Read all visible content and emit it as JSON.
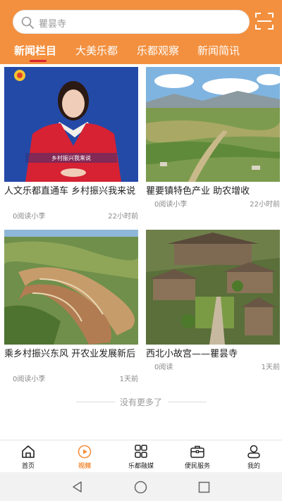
{
  "search": {
    "placeholder": "瞿昙寺"
  },
  "tabs": [
    {
      "label": "新闻栏目",
      "active": true
    },
    {
      "label": "大美乐都",
      "active": false
    },
    {
      "label": "乐都观察",
      "active": false
    },
    {
      "label": "新闻简讯",
      "active": false
    }
  ],
  "cards": [
    {
      "title": "人文乐都直通车 乡村振兴我来说",
      "reads": "0阅读小李",
      "time": "22小时前",
      "overlay_text": "乡村振兴我来说"
    },
    {
      "title": "瞿要镇特色产业 助农增收",
      "reads": "0阅读小李",
      "time": "22小时前"
    },
    {
      "title": "乘乡村振兴东风 开农业发展新后",
      "reads": "0阅读小李",
      "time": "1天前"
    },
    {
      "title": "西北小故宫——瞿昙寺",
      "reads": "0阅读",
      "time": "1天前"
    }
  ],
  "footer": {
    "no_more": "没有更多了"
  },
  "nav": [
    {
      "label": "首页",
      "icon": "home-icon",
      "active": false
    },
    {
      "label": "视频",
      "icon": "video-icon",
      "active": true
    },
    {
      "label": "乐都融媒",
      "icon": "grid-icon",
      "active": false
    },
    {
      "label": "便民服务",
      "icon": "briefcase-icon",
      "active": false
    },
    {
      "label": "我的",
      "icon": "user-icon",
      "active": false
    }
  ],
  "colors": {
    "brand": "#f3903f",
    "underline": "#d9232f"
  }
}
